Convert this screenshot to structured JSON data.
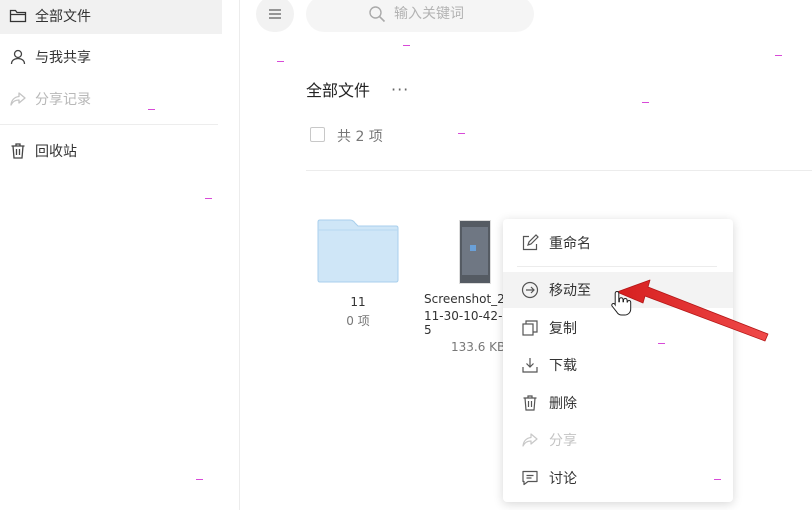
{
  "sidebar": {
    "items": [
      {
        "label": "全部文件",
        "icon": "folder-icon",
        "active": true
      },
      {
        "label": "与我共享",
        "icon": "person-icon"
      },
      {
        "label": "分享记录",
        "icon": "share-icon",
        "disabled": true
      },
      {
        "label": "回收站",
        "icon": "trash-icon"
      }
    ]
  },
  "search": {
    "placeholder": "输入关键词"
  },
  "main": {
    "title": "全部文件",
    "more": "···",
    "count": "共 2 项",
    "files": [
      {
        "name": "11",
        "meta": "0 项",
        "icon": "folder-icon"
      },
      {
        "name_line1": "Screenshot_20",
        "name_line2": "11-30-10-42-5",
        "size": "133.6 KB",
        "icon": "image-thumbnail"
      }
    ]
  },
  "context_menu": {
    "items": [
      {
        "label": "重命名",
        "icon": "edit-icon"
      },
      {
        "label": "移动至",
        "icon": "move-icon",
        "hovered": true
      },
      {
        "label": "复制",
        "icon": "copy-icon"
      },
      {
        "label": "下载",
        "icon": "download-icon"
      },
      {
        "label": "删除",
        "icon": "trash-icon"
      },
      {
        "label": "分享",
        "icon": "share-icon",
        "disabled": true
      },
      {
        "label": "讨论",
        "icon": "comment-icon"
      }
    ]
  },
  "colors": {
    "accent_arrow": "#e02424",
    "folder": "#cfe6f7",
    "menu_hover": "#f3f3f3"
  }
}
